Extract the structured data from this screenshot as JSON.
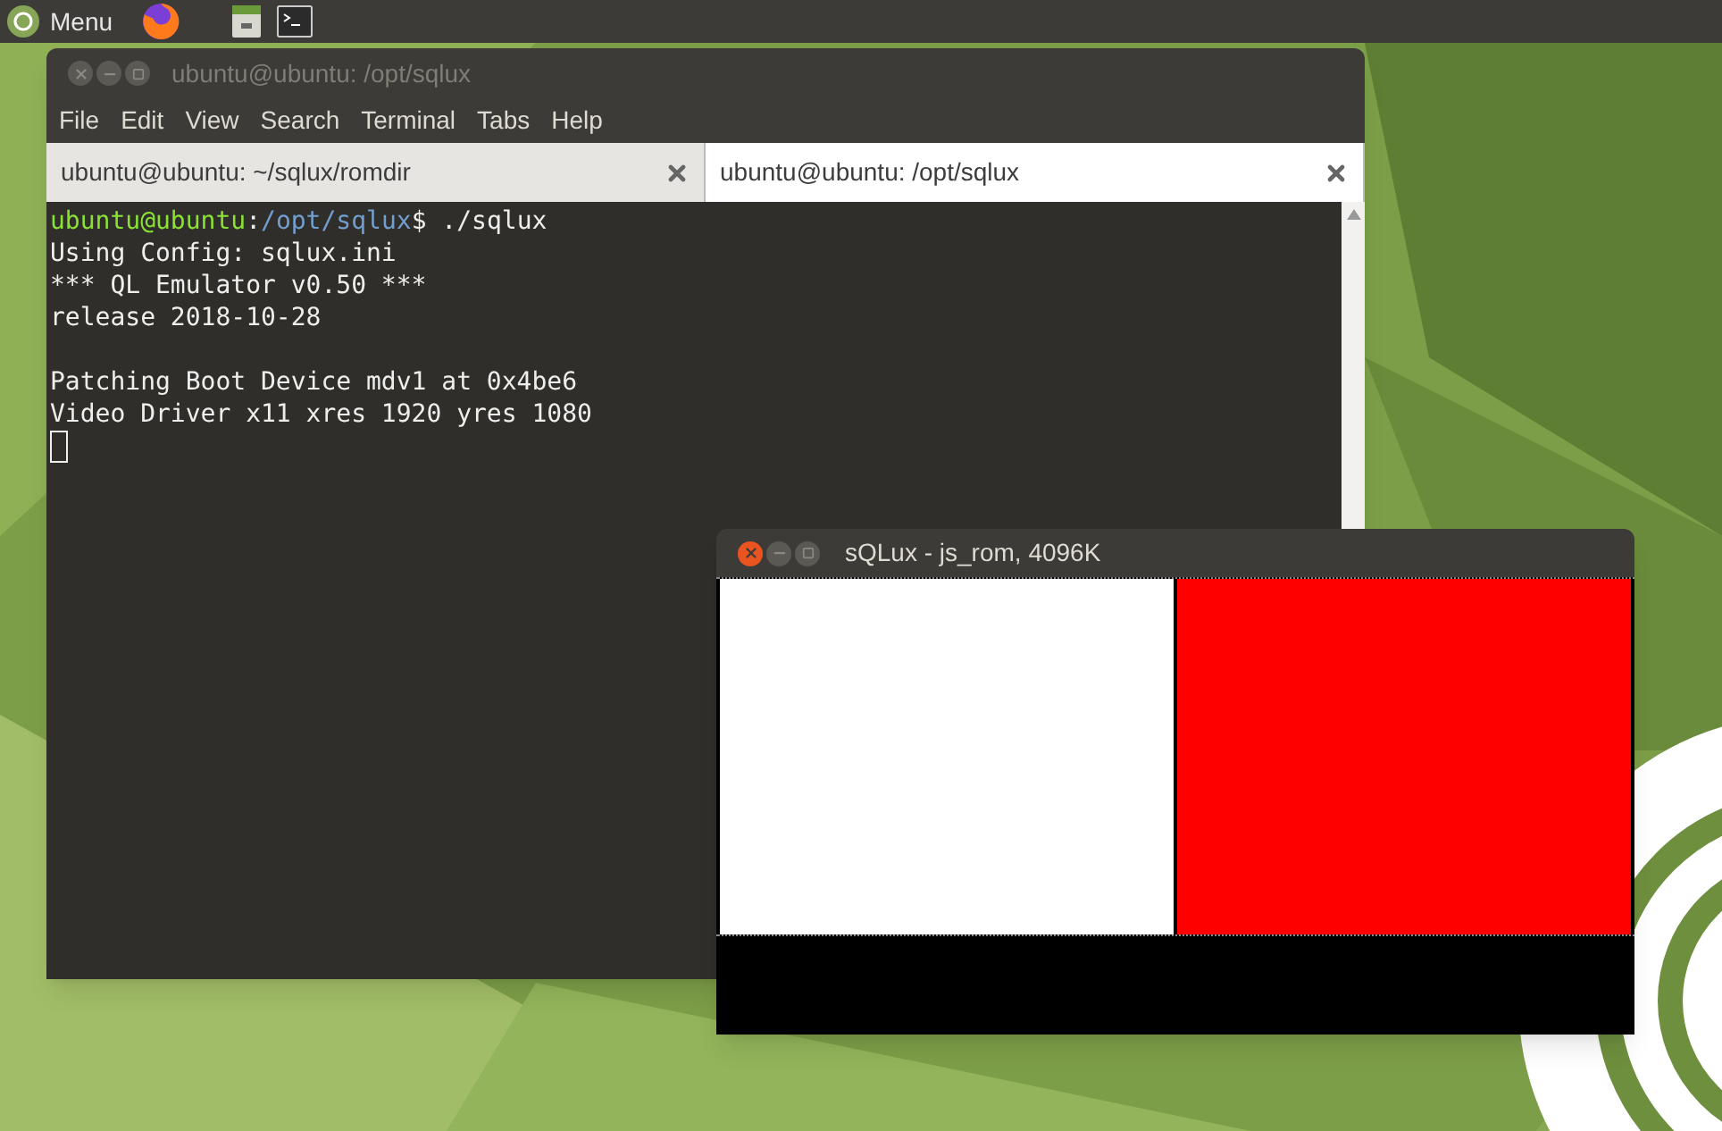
{
  "top_panel": {
    "menu_label": "Menu"
  },
  "terminal": {
    "title": "ubuntu@ubuntu: /opt/sqlux",
    "focused": false,
    "menu": [
      "File",
      "Edit",
      "View",
      "Search",
      "Terminal",
      "Tabs",
      "Help"
    ],
    "tabs": [
      {
        "label": "ubuntu@ubuntu: ~/sqlux/romdir",
        "selected": false
      },
      {
        "label": "ubuntu@ubuntu: /opt/sqlux",
        "selected": true
      }
    ],
    "lines": [
      [
        {
          "kind": "user",
          "text": "ubuntu@ubuntu"
        },
        {
          "kind": "plain",
          "text": ":"
        },
        {
          "kind": "path",
          "text": "/opt/sqlux"
        },
        {
          "kind": "plain",
          "text": "$ ./sqlux"
        }
      ],
      [
        {
          "kind": "plain",
          "text": "Using Config: sqlux.ini"
        }
      ],
      [
        {
          "kind": "plain",
          "text": "*** QL Emulator v0.50 ***"
        }
      ],
      [
        {
          "kind": "plain",
          "text": "release 2018-10-28"
        }
      ],
      {
        "kind": "blank"
      },
      [
        {
          "kind": "plain",
          "text": "Patching Boot Device mdv1 at 0x4be6"
        }
      ],
      [
        {
          "kind": "plain",
          "text": "Video Driver x11 xres 1920 yres 1080"
        }
      ]
    ]
  },
  "emulator": {
    "title": "sQLux - js_rom, 4096K",
    "focused": true
  }
}
